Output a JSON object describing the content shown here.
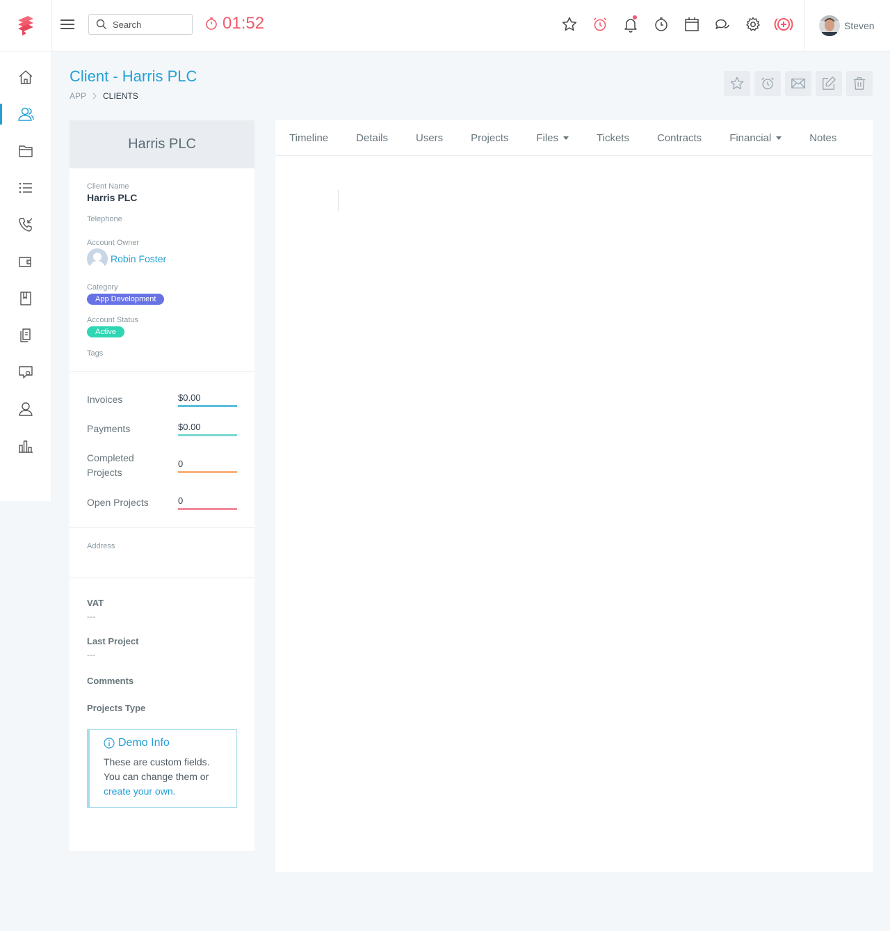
{
  "header": {
    "search": {
      "placeholder": "Search"
    },
    "timer": "01:52",
    "icons": [
      "star-icon",
      "alarm-icon",
      "bell-icon",
      "stopwatch-icon",
      "calendar-icon",
      "chat-icon",
      "gear-icon",
      "add-circle-icon"
    ],
    "user": {
      "name": "Steven"
    }
  },
  "sidebar": {
    "items": [
      "home-icon",
      "users-icon",
      "folder-icon",
      "list-icon",
      "phone-icon",
      "wallet-icon",
      "book-icon",
      "documents-icon",
      "support-icon",
      "person-icon",
      "bar-chart-icon"
    ],
    "active_index": 1
  },
  "page": {
    "title": "Client - Harris PLC",
    "breadcrumb": {
      "root": "APP",
      "current": "CLIENTS"
    }
  },
  "actions": [
    "star-icon",
    "alarm-icon",
    "mail-icon",
    "edit-icon",
    "trash-icon"
  ],
  "client": {
    "header": "Harris PLC",
    "name_label": "Client Name",
    "name": "Harris PLC",
    "telephone_label": "Telephone",
    "owner_label": "Account Owner",
    "owner": "Robin Foster",
    "category_label": "Category",
    "category": "App Development",
    "status_label": "Account Status",
    "status": "Active",
    "tags_label": "Tags"
  },
  "stats": [
    {
      "label": "Invoices",
      "value": "$0.00",
      "color": "#5bc0de"
    },
    {
      "label": "Payments",
      "value": "$0.00",
      "color": "#7ad7d5"
    },
    {
      "label": "Completed Projects",
      "value": "0",
      "color": "#f6b07a"
    },
    {
      "label": "Open Projects",
      "value": "0",
      "color": "#f48a9b"
    }
  ],
  "address_label": "Address",
  "custom_fields": {
    "vat_label": "VAT",
    "vat_value": "---",
    "last_project_label": "Last Project",
    "last_project_value": "---",
    "comments_label": "Comments",
    "projects_type_label": "Projects Type"
  },
  "demo": {
    "title": "Demo Info",
    "text": "These are custom fields. You can change them or ",
    "link": "create your own."
  },
  "tabs": [
    {
      "label": "Timeline",
      "dropdown": false
    },
    {
      "label": "Details",
      "dropdown": false
    },
    {
      "label": "Users",
      "dropdown": false
    },
    {
      "label": "Projects",
      "dropdown": false
    },
    {
      "label": "Files",
      "dropdown": true
    },
    {
      "label": "Tickets",
      "dropdown": false
    },
    {
      "label": "Contracts",
      "dropdown": false
    },
    {
      "label": "Financial",
      "dropdown": true
    },
    {
      "label": "Notes",
      "dropdown": false
    }
  ],
  "colors": {
    "accent": "#24a0d6",
    "timer": "#f2596c",
    "category_badge": "#6772e5",
    "status_badge": "#2fd6b4"
  }
}
